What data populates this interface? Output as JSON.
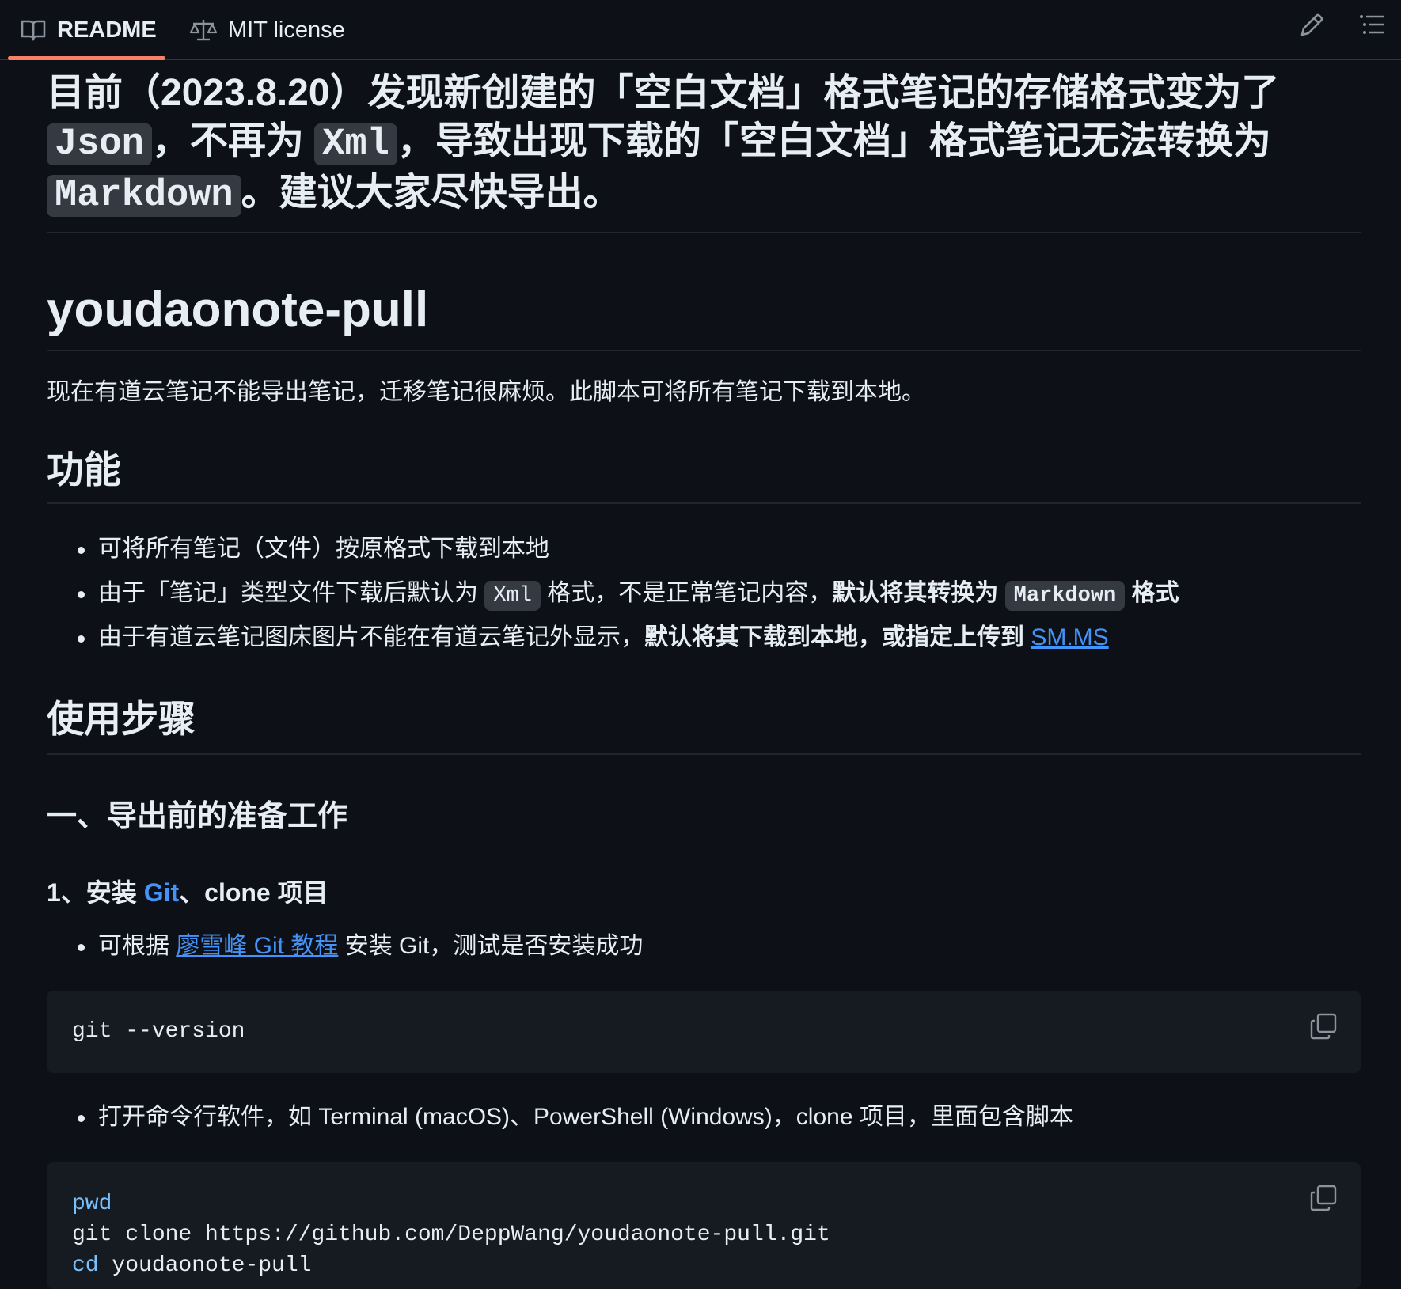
{
  "tabs": {
    "readme": "README",
    "license": "MIT license"
  },
  "notice": {
    "part1": "目前（2023.8.20）发现新创建的「空白文档」格式笔记的存储格式变为了",
    "code1": "Json",
    "part2": "，不再为",
    "code2": "Xml",
    "part3": "，导致出现下载的「空白文档」格式笔记无法转换为",
    "code3": "Markdown",
    "part4": "。建议大家尽快导出。"
  },
  "title": "youdaonote-pull",
  "intro": "现在有道云笔记不能导出笔记，迁移笔记很麻烦。此脚本可将所有笔记下载到本地。",
  "features": {
    "heading": "功能",
    "item1": "可将所有笔记（文件）按原格式下载到本地",
    "item2_a": "由于「笔记」类型文件下载后默认为",
    "item2_code": "Xml",
    "item2_b": "格式，不是正常笔记内容，",
    "item2_bold": "默认将其转换为",
    "item2_code2": "Markdown",
    "item2_bold2": "格式",
    "item3_a": "由于有道云笔记图床图片不能在有道云笔记外显示，",
    "item3_bold": "默认将其下载到本地，或指定上传到",
    "item3_link": "SM.MS"
  },
  "usage": {
    "heading": "使用步骤",
    "section1": "一、导出前的准备工作",
    "step1_a": "1、安装",
    "step1_link": "Git",
    "step1_b": "、clone 项目",
    "bullet1_a": "可根据",
    "bullet1_link": "廖雪峰 Git 教程",
    "bullet1_b": "安装 Git，测试是否安装成功",
    "code_version": "git --version",
    "bullet2": "打开命令行软件，如 Terminal (macOS)、PowerShell (Windows)，clone 项目，里面包含脚本",
    "code2_line1": "pwd",
    "code2_line2": "git clone https://github.com/DeppWang/youdaonote-pull.git",
    "code2_line3_kw": "cd",
    "code2_line3_rest": " youdaonote-pull"
  }
}
